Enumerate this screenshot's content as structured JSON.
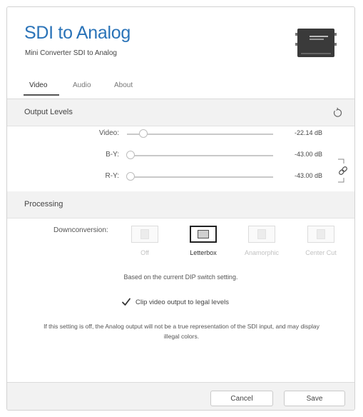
{
  "header": {
    "title": "SDI to Analog",
    "subtitle": "Mini Converter SDI to Analog",
    "device_icon": "converter-device-icon"
  },
  "tabs": [
    {
      "label": "Video",
      "active": true
    },
    {
      "label": "Audio",
      "active": false
    },
    {
      "label": "About",
      "active": false
    }
  ],
  "output_levels": {
    "title": "Output Levels",
    "reset_icon": "reset-icon",
    "link_icon": "link-icon",
    "sliders": [
      {
        "label": "Video:",
        "value": "-22.14 dB",
        "position": 0.09
      },
      {
        "label": "B-Y:",
        "value": "-43.00 dB",
        "position": 0.0
      },
      {
        "label": "R-Y:",
        "value": "-43.00 dB",
        "position": 0.0
      }
    ]
  },
  "processing": {
    "title": "Processing",
    "downconversion_label": "Downconversion:",
    "options": [
      {
        "label": "Off",
        "selected": false
      },
      {
        "label": "Letterbox",
        "selected": true
      },
      {
        "label": "Anamorphic",
        "selected": false
      },
      {
        "label": "Center Cut",
        "selected": false
      }
    ],
    "dip_note": "Based on the current DIP switch setting.",
    "clip_label": "Clip video output to legal levels",
    "clip_checked": true,
    "warning": "If this setting is off, the Analog output will not be a true representation of the SDI input, and may display illegal colors."
  },
  "footer": {
    "cancel_label": "Cancel",
    "save_label": "Save"
  },
  "colors": {
    "title": "#2a73b8",
    "section_bg": "#f2f2f2"
  }
}
